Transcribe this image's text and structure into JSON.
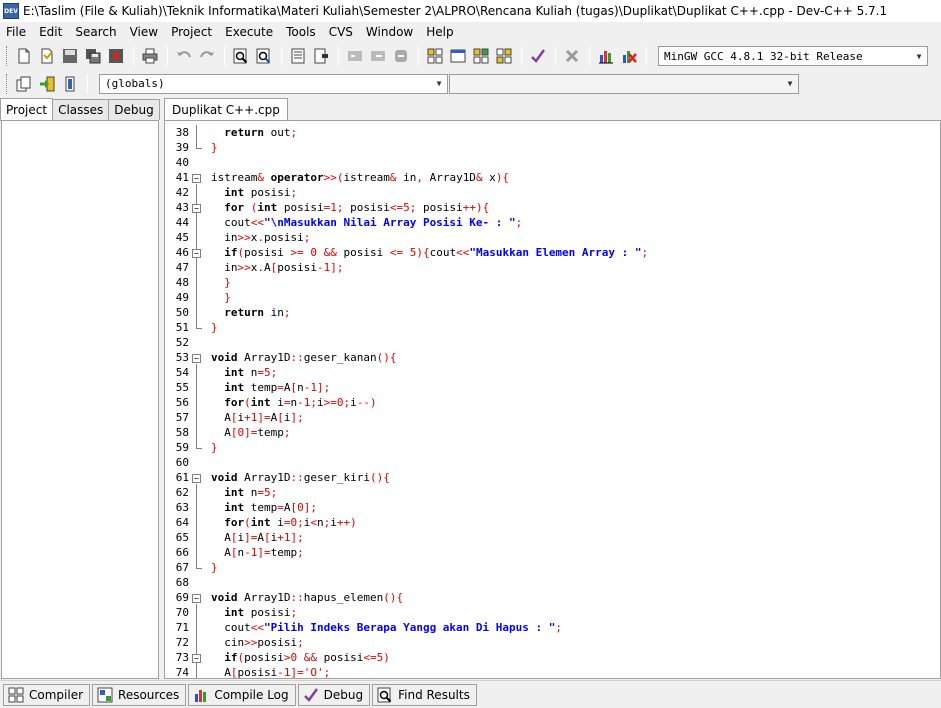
{
  "window": {
    "title": "E:\\Taslim (File & Kuliah)\\Teknik Informatika\\Materi Kuliah\\Semester 2\\ALPRO\\Rencana Kuliah (tugas)\\Duplikat\\Duplikat C++.cpp - Dev-C++ 5.7.1",
    "app_icon_text": "DEV"
  },
  "menu": [
    "File",
    "Edit",
    "Search",
    "View",
    "Project",
    "Execute",
    "Tools",
    "CVS",
    "Window",
    "Help"
  ],
  "toolbar": {
    "compiler_select": "MinGW GCC 4.8.1 32-bit Release",
    "globals_select": "(globals)",
    "members_select": ""
  },
  "left_tabs": [
    "Project",
    "Classes",
    "Debug"
  ],
  "editor": {
    "tab_label": "Duplikat C++.cpp",
    "line_numbers": [
      "38",
      "39",
      "40",
      "41",
      "42",
      "43",
      "44",
      "45",
      "46",
      "47",
      "48",
      "49",
      "50",
      "51",
      "52",
      "53",
      "54",
      "55",
      "56",
      "57",
      "58",
      "59",
      "60",
      "61",
      "62",
      "63",
      "64",
      "65",
      "66",
      "67",
      "68",
      "69",
      "70",
      "71",
      "72",
      "73",
      "74"
    ]
  },
  "bottom_tabs": [
    "Compiler",
    "Resources",
    "Compile Log",
    "Debug",
    "Find Results"
  ],
  "colors": {
    "keyword": "#000000",
    "number": "#e00000",
    "string": "#0000ff",
    "panel_bg": "#f0f0f0"
  }
}
